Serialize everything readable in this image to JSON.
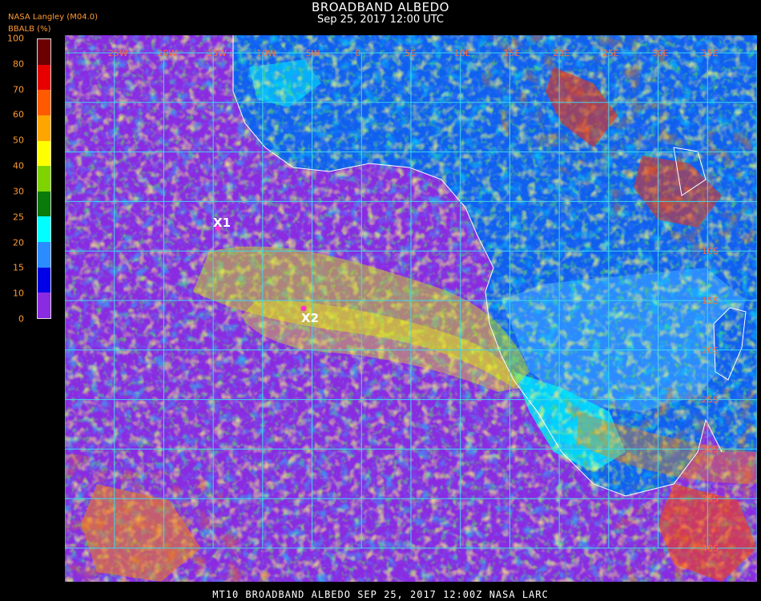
{
  "header": {
    "title": "BROADBAND ALBEDO",
    "datetime": "Sep 25, 2017 12:00 UTC",
    "credit": "NASA Langley (M04.0)",
    "units": "BBALB (%)"
  },
  "colorbar": {
    "ticks": [
      "100",
      "80",
      "70",
      "60",
      "50",
      "40",
      "30",
      "25",
      "20",
      "15",
      "10",
      "0"
    ],
    "bins": [
      {
        "range": "80-100",
        "color": "#6b0000"
      },
      {
        "range": "70-80",
        "color": "#e60000"
      },
      {
        "range": "60-70",
        "color": "#ff5a00"
      },
      {
        "range": "50-60",
        "color": "#ffa500"
      },
      {
        "range": "40-50",
        "color": "#ffff00"
      },
      {
        "range": "30-40",
        "color": "#7fd400"
      },
      {
        "range": "25-30",
        "color": "#0a7a0a"
      },
      {
        "range": "20-25",
        "color": "#00ffff"
      },
      {
        "range": "15-20",
        "color": "#2a8cff"
      },
      {
        "range": "10-15",
        "color": "#0000e6"
      },
      {
        "range": "0-10",
        "color": "#8a2be2"
      }
    ]
  },
  "map": {
    "colors": {
      "ocean": "#8a2be2",
      "land": "#1060f0",
      "grid": "#3fd8e8",
      "coast": "#ffffff",
      "marker": "#ff33cc"
    },
    "markers": [
      {
        "label": "X1"
      },
      {
        "label": "X2"
      }
    ],
    "lat_labels": [
      "10S",
      "15S",
      "20S",
      "25S",
      "30S",
      "35S",
      "40S"
    ],
    "lon_labels": [
      "25W",
      "20W",
      "15W",
      "10W",
      "5W",
      "0",
      "5E",
      "10E",
      "15E",
      "20E",
      "25E",
      "30E",
      "35E"
    ]
  },
  "footer": {
    "caption": "MT10  BROADBAND ALBEDO   SEP 25, 2017 12:00Z   NASA LARC"
  }
}
